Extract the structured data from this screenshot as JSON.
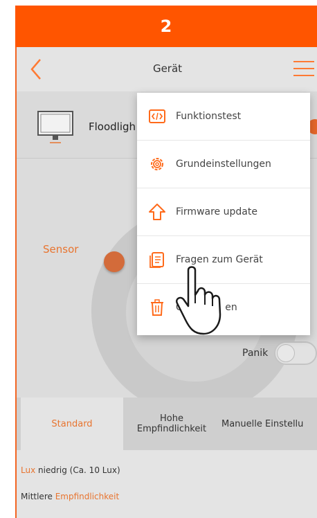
{
  "step": "2",
  "nav": {
    "title": "Gerät"
  },
  "device": {
    "name": "Floodligh"
  },
  "main": {
    "sensor_label": "Sensor",
    "panik_label": "Panik"
  },
  "menu": {
    "items": [
      {
        "label": "Funktionstest",
        "icon": "code-icon"
      },
      {
        "label": "Grundeinstellungen",
        "icon": "gear-icon"
      },
      {
        "label": "Firmware update",
        "icon": "arrow-up-icon"
      },
      {
        "label": "Fragen zum Gerät",
        "icon": "document-icon"
      },
      {
        "label": "Ger",
        "label_end": "en",
        "icon": "trash-icon"
      }
    ]
  },
  "tabs": [
    {
      "label": "Standard"
    },
    {
      "label": "Hohe\nEmpfindlichkeit"
    },
    {
      "label": "Manuelle Einstellu"
    }
  ],
  "info": {
    "line1_hl": "Lux",
    "line1_rest": " niedrig (Ca. 10 Lux)",
    "line2_rest": "Mittlere ",
    "line2_hl": "Empfindlichkeit"
  },
  "colors": {
    "accent": "#ff5500",
    "accent_text": "#e8742f"
  }
}
